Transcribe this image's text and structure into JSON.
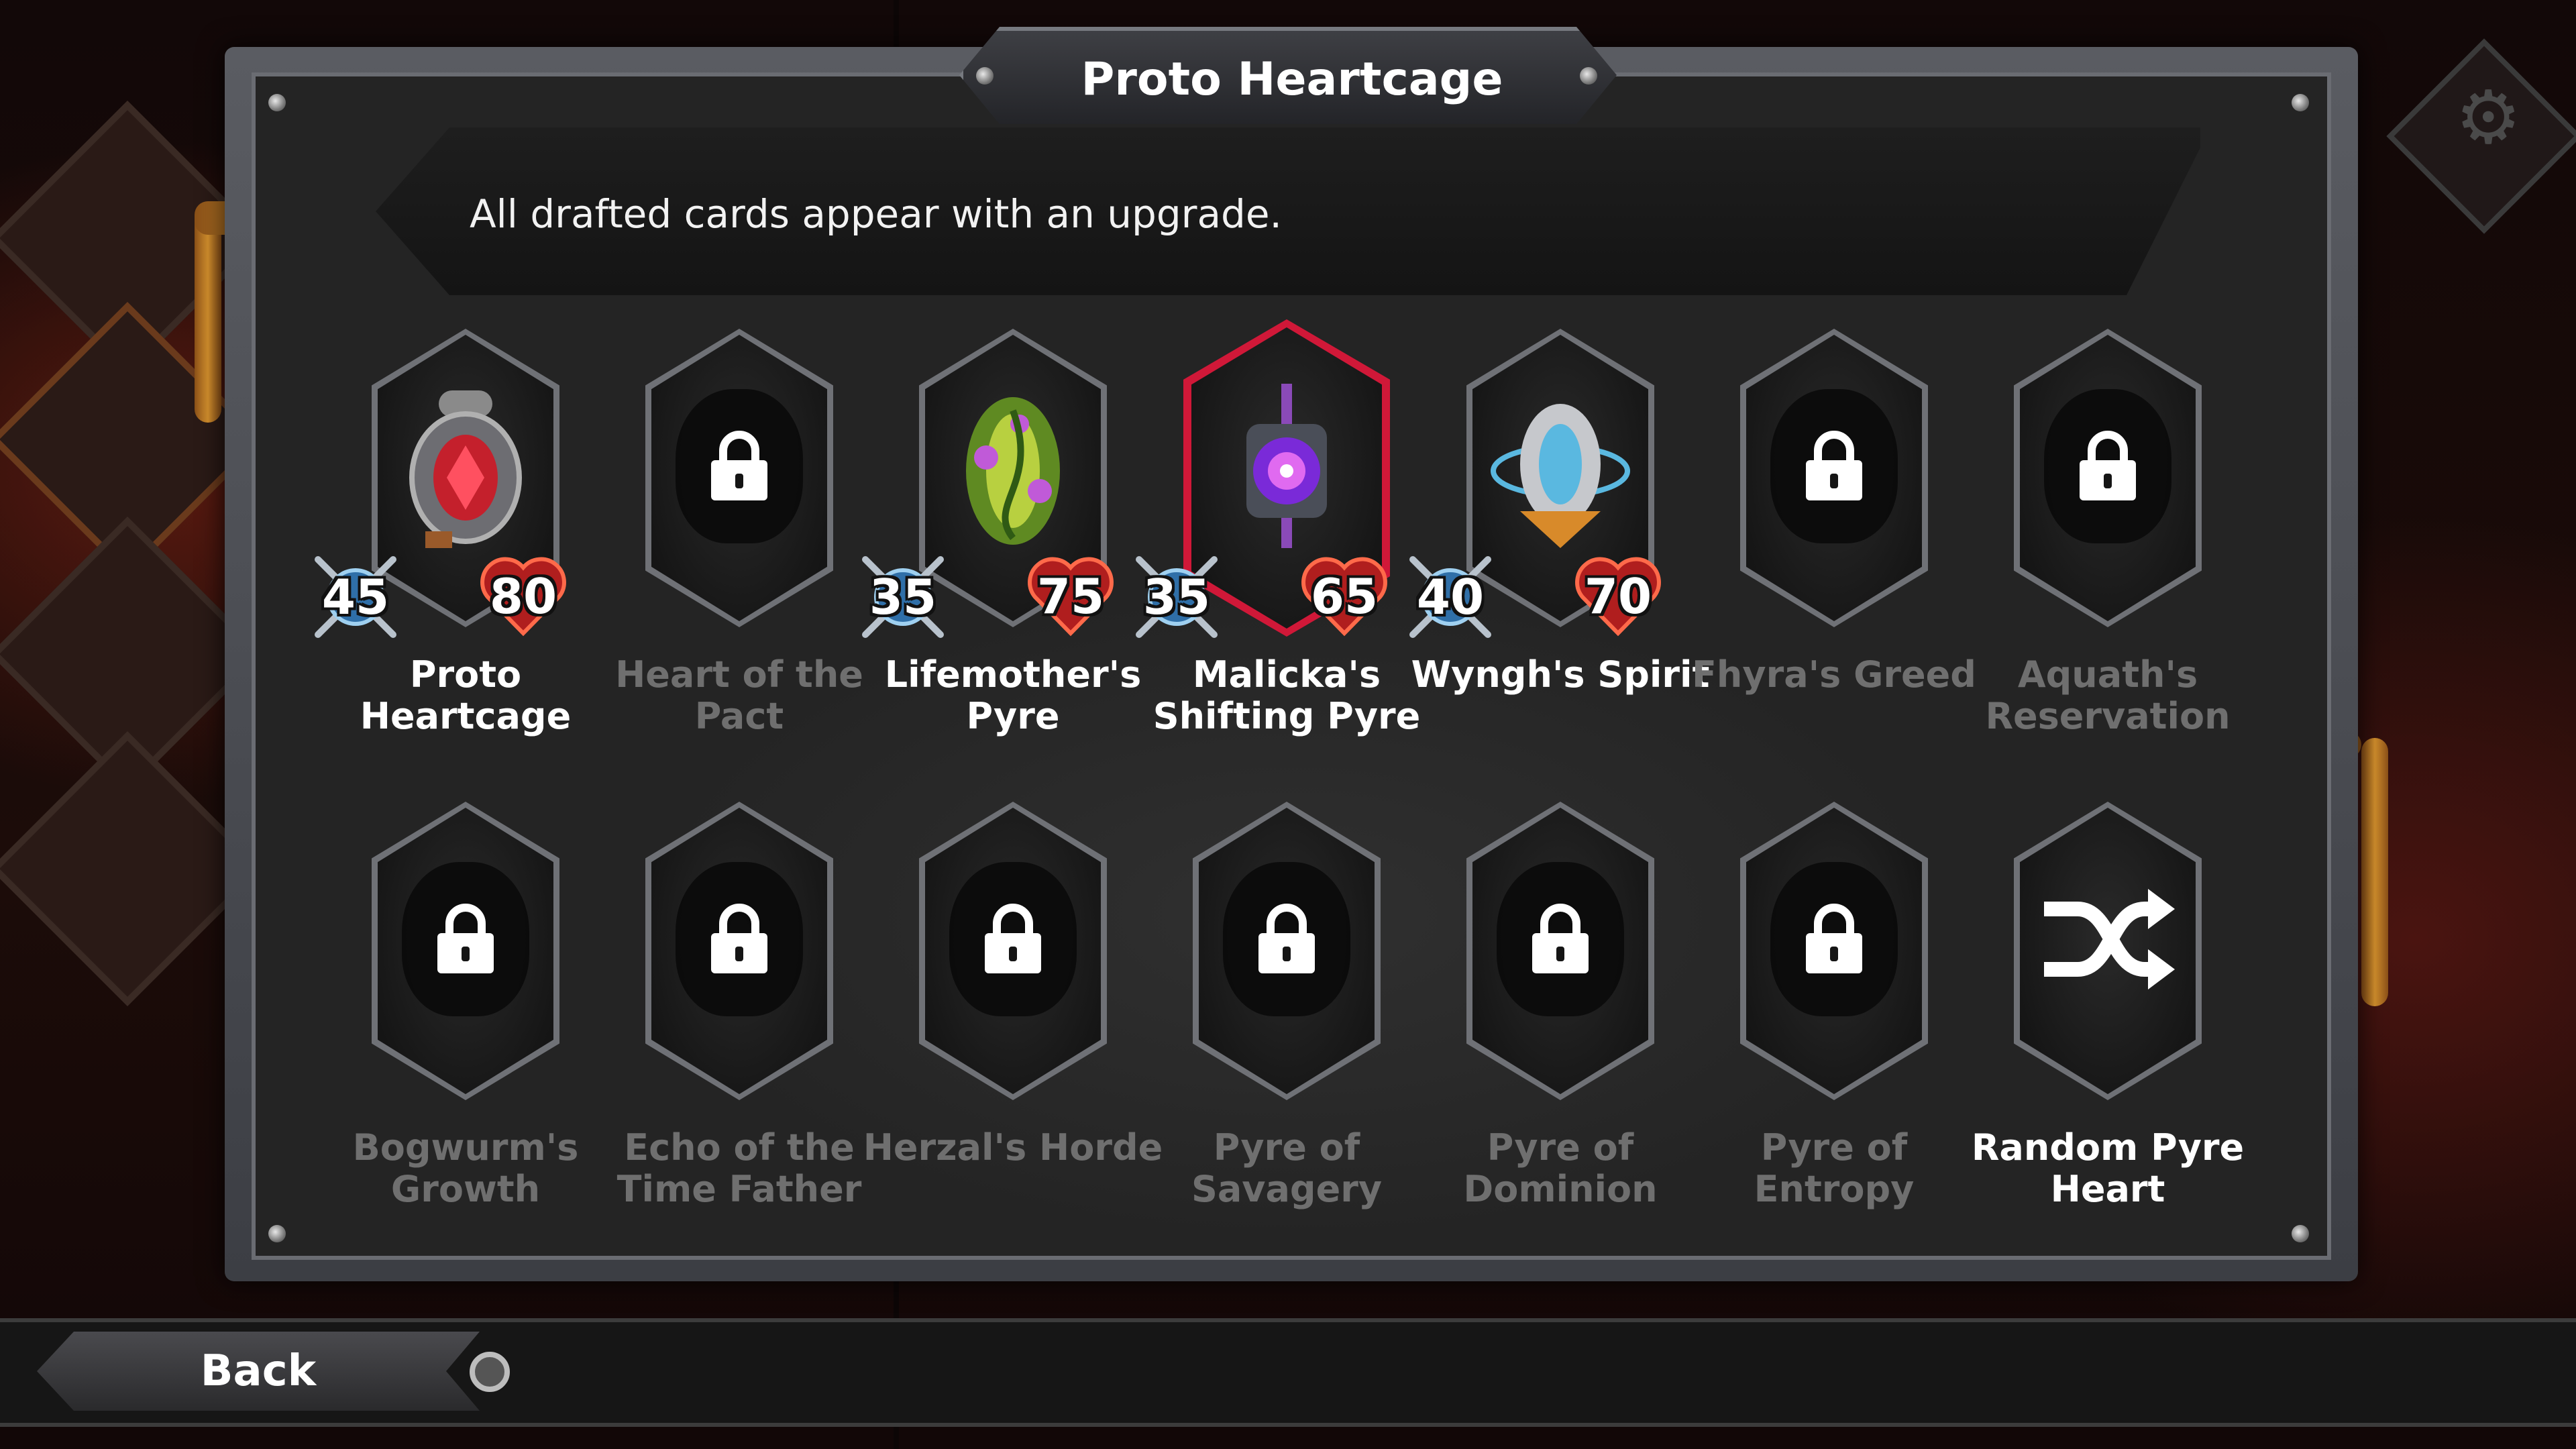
{
  "title": "Proto Heartcage",
  "description": "All drafted cards appear with an upgrade.",
  "back_button": {
    "label": "Back"
  },
  "pyre_hearts": [
    {
      "name": "Proto Heartcage",
      "unlocked": true,
      "selected": false,
      "attack": "45",
      "health": "80",
      "art": "heartcage-icon"
    },
    {
      "name": "Heart of the Pact",
      "unlocked": false,
      "selected": false,
      "art": "lock-icon"
    },
    {
      "name": "Lifemother's Pyre",
      "unlocked": true,
      "selected": false,
      "attack": "35",
      "health": "75",
      "art": "lifemother-icon"
    },
    {
      "name": "Malicka's Shifting Pyre",
      "unlocked": true,
      "selected": true,
      "attack": "35",
      "health": "65",
      "art": "shifting-pyre-icon"
    },
    {
      "name": "Wyngh's Spirit",
      "unlocked": true,
      "selected": false,
      "attack": "40",
      "health": "70",
      "art": "wyngh-spirit-icon"
    },
    {
      "name": "Fhyra's Greed",
      "unlocked": false,
      "selected": false,
      "art": "lock-icon"
    },
    {
      "name": "Aquath's Reservation",
      "unlocked": false,
      "selected": false,
      "art": "lock-icon"
    },
    {
      "name": "Bogwurm's Growth",
      "unlocked": false,
      "selected": false,
      "art": "lock-icon"
    },
    {
      "name": "Echo of the Time Father",
      "unlocked": false,
      "selected": false,
      "art": "lock-icon"
    },
    {
      "name": "Herzal's Horde",
      "unlocked": false,
      "selected": false,
      "art": "lock-icon"
    },
    {
      "name": "Pyre of Savagery",
      "unlocked": false,
      "selected": false,
      "art": "lock-icon"
    },
    {
      "name": "Pyre of Dominion",
      "unlocked": false,
      "selected": false,
      "art": "lock-icon"
    },
    {
      "name": "Pyre of Entropy",
      "unlocked": false,
      "selected": false,
      "art": "lock-icon"
    },
    {
      "name": "Random Pyre Heart",
      "unlocked": true,
      "selected": false,
      "art": "shuffle-icon"
    }
  ],
  "colors": {
    "selected_border": "#d01838",
    "locked_text": "#6f6f6f",
    "unlocked_text": "#ffffff"
  }
}
